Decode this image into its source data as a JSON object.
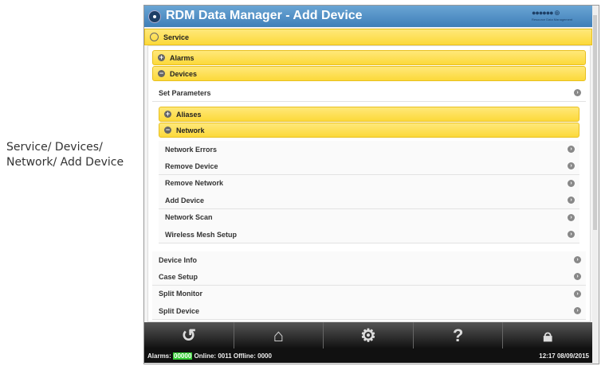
{
  "caption": "Service/ Devices/ Network/ Add Device",
  "header": {
    "title": "RDM Data Manager - Add Device",
    "logo": "Resource Data Management"
  },
  "service": "Service",
  "alarms": "Alarms",
  "devices": "Devices",
  "set_parameters": "Set Parameters",
  "aliases": "Aliases",
  "network": "Network",
  "network_items": [
    "Network Errors",
    "Remove Device",
    "Remove Network",
    "Add Device",
    "Network Scan",
    "Wireless Mesh Setup"
  ],
  "device_items": [
    "Device Info",
    "Case Setup",
    "Split Monitor",
    "Split Device"
  ],
  "status": {
    "alarms_label": "Alarms:",
    "alarms": "00000",
    "online_label": "Online:",
    "online": "0011",
    "offline_label": "Offline:",
    "offline": "0000",
    "datetime": "12:17 08/09/2015"
  },
  "toolbar": {
    "help": "?"
  }
}
